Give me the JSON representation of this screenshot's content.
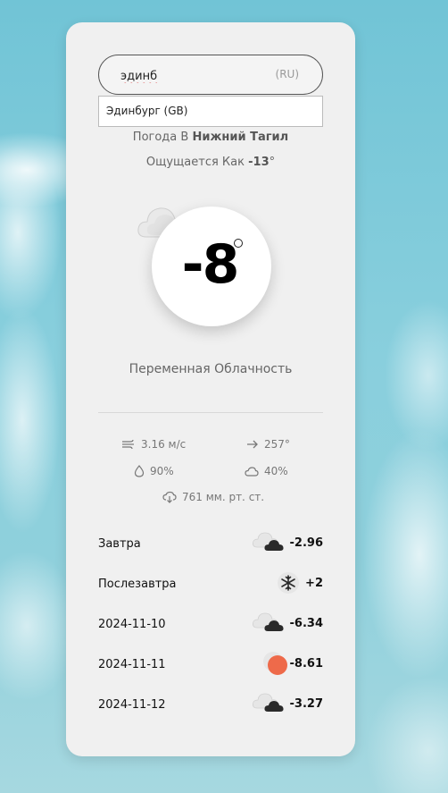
{
  "search": {
    "value": "эдинб",
    "lang": "(RU)"
  },
  "suggestions": [
    {
      "label": "Эдинбург (GB)"
    }
  ],
  "current": {
    "city_prefix": "Погода В",
    "city": "Нижний Тагил",
    "feels_prefix": "Ощущается Как",
    "feels_value": "-13",
    "feels_deg": "°",
    "temp": "-8",
    "description": "Переменная Облачность",
    "icon": "partly-cloudy-icon"
  },
  "stats": {
    "wind": "3.16 м/с",
    "direction": "257°",
    "humidity": "90%",
    "clouds": "40%",
    "pressure": "761 мм. рт. ст."
  },
  "forecast": [
    {
      "date": "Завтра",
      "temp": "-2.96",
      "icon": "cloudy-icon"
    },
    {
      "date": "Послезавтра",
      "temp": "+2",
      "icon": "snow-icon"
    },
    {
      "date": "2024-11-10",
      "temp": "-6.34",
      "icon": "cloudy-icon"
    },
    {
      "date": "2024-11-11",
      "temp": "-8.61",
      "icon": "sun-icon"
    },
    {
      "date": "2024-11-12",
      "temp": "-3.27",
      "icon": "cloudy-icon"
    }
  ],
  "colors": {
    "card": "#f0f0f0",
    "sun": "#ee6a4a",
    "accent_text": "#111111"
  }
}
